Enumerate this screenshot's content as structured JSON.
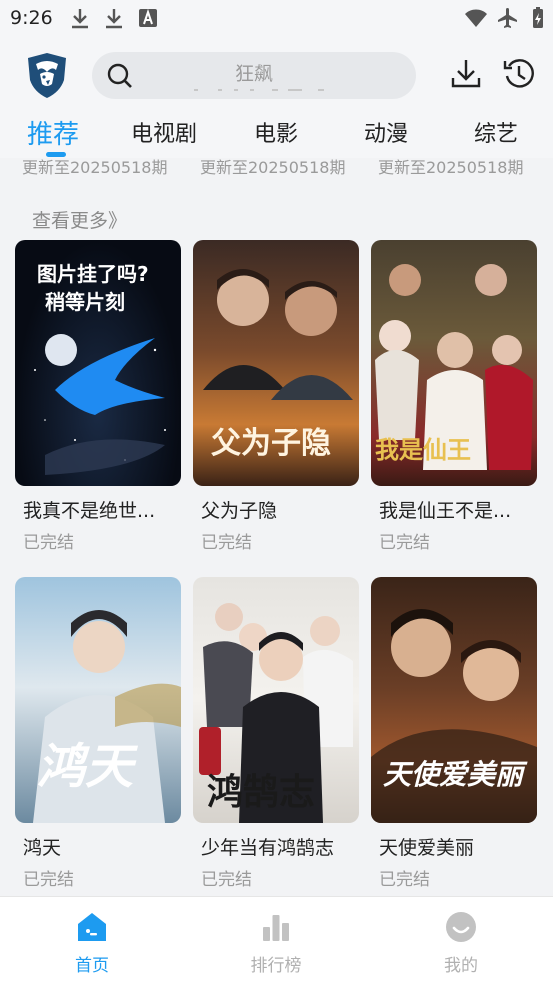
{
  "status_bar": {
    "time": "9:26"
  },
  "search": {
    "placeholder": "狂飙"
  },
  "tabs": [
    {
      "label": "推荐",
      "active": true
    },
    {
      "label": "电视剧"
    },
    {
      "label": "电影"
    },
    {
      "label": "动漫"
    },
    {
      "label": "综艺"
    }
  ],
  "update_texts": [
    "更新至20250518期",
    "更新至20250518期",
    "更新至20250518期"
  ],
  "see_more": "查看更多》",
  "cards": [
    {
      "title": "我真不是绝世...",
      "status": "已完结",
      "poster_text": [
        "图片挂了吗?",
        "稍等片刻"
      ]
    },
    {
      "title": "父为子隐",
      "status": "已完结",
      "poster_text": "父为子隐"
    },
    {
      "title": "我是仙王不是...",
      "status": "已完结",
      "poster_text": "我是仙王"
    },
    {
      "title": "鸿天",
      "status": "已完结",
      "poster_text": "鸿天"
    },
    {
      "title": "少年当有鸿鹄志",
      "status": "已完结",
      "poster_text": "鸿鹄志"
    },
    {
      "title": "天使爱美丽",
      "status": "已完结",
      "poster_text": "天使爱美丽"
    }
  ],
  "bottom_nav": [
    {
      "label": "首页",
      "icon": "home-icon",
      "active": true
    },
    {
      "label": "排行榜",
      "icon": "rank-icon"
    },
    {
      "label": "我的",
      "icon": "profile-icon"
    }
  ],
  "colors": {
    "accent": "#1d9bf0",
    "muted": "#9a9a9a"
  }
}
